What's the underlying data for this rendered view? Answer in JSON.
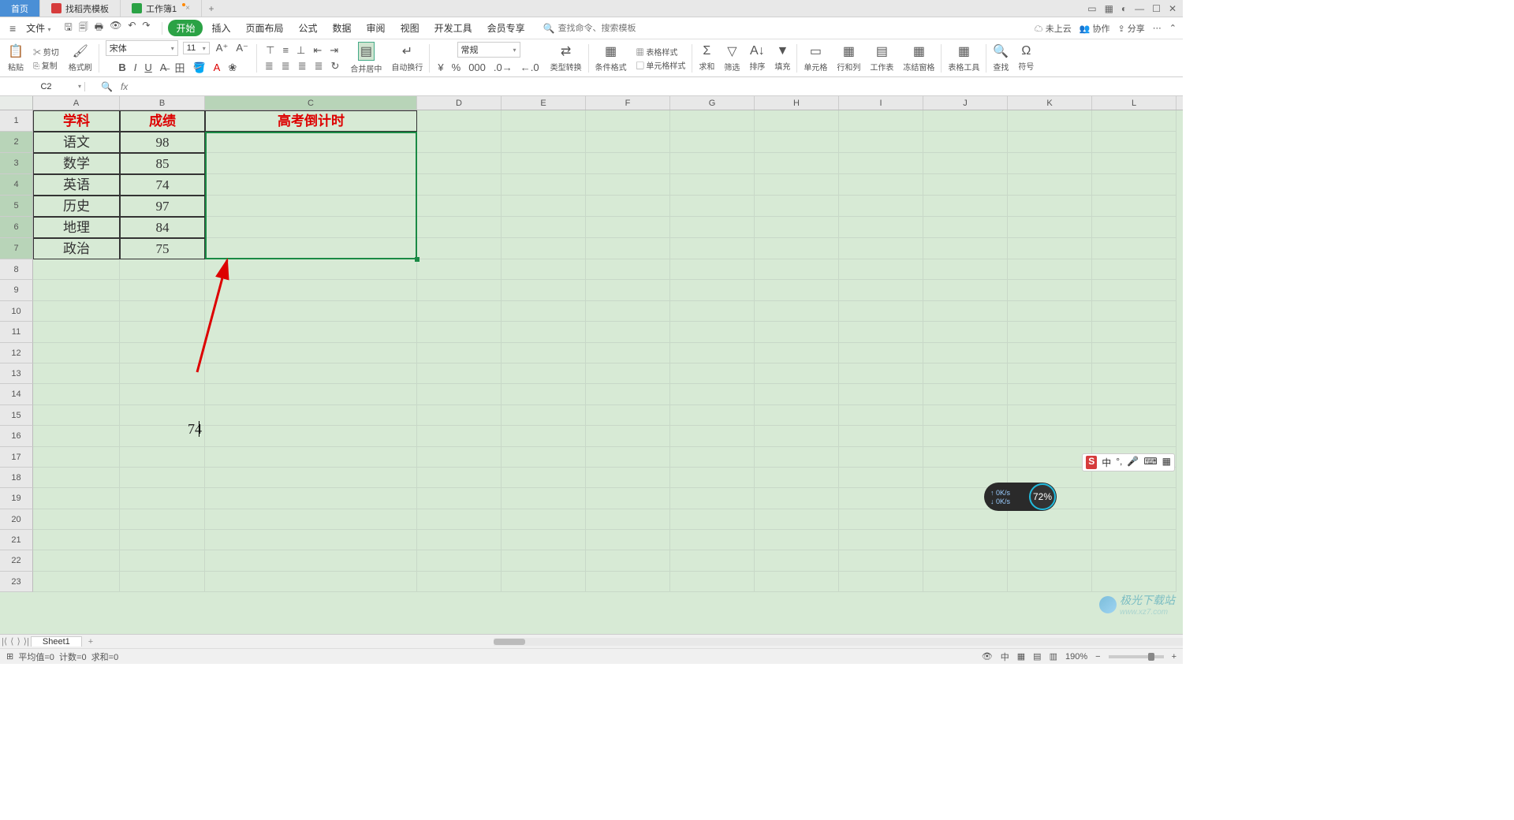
{
  "tabs": {
    "home": "首页",
    "templates": "找稻壳模板",
    "workbook": "工作簿1"
  },
  "menu": {
    "file": "文件",
    "items": [
      "开始",
      "插入",
      "页面布局",
      "公式",
      "数据",
      "审阅",
      "视图",
      "开发工具",
      "会员专享"
    ],
    "search_placeholder": "查找命令、搜索模板",
    "cloud": "未上云",
    "coop": "协作",
    "share": "分享"
  },
  "ribbon": {
    "paste": "粘贴",
    "cut": "剪切",
    "copy": "复制",
    "format_painter": "格式刷",
    "font_name": "宋体",
    "font_size": "11",
    "merge": "合并居中",
    "wrap": "自动换行",
    "number_fmt": "常规",
    "type_convert": "类型转换",
    "cond_fmt": "条件格式",
    "table_style": "表格样式",
    "cell_style": "单元格样式",
    "sum": "求和",
    "filter": "筛选",
    "sort": "排序",
    "fill": "填充",
    "cell": "单元格",
    "rows_cols": "行和列",
    "worksheet": "工作表",
    "freeze": "冻结窗格",
    "table_tools": "表格工具",
    "find": "查找",
    "symbol": "符号"
  },
  "namebox": "C2",
  "columns": [
    "A",
    "B",
    "C",
    "D",
    "E",
    "F",
    "G",
    "H",
    "I",
    "J",
    "K",
    "L"
  ],
  "rows_n": 23,
  "table": {
    "headers": [
      "学科",
      "成绩",
      "高考倒计时"
    ],
    "data": [
      [
        "语文",
        "98"
      ],
      [
        "数学",
        "85"
      ],
      [
        "英语",
        "74"
      ],
      [
        "历史",
        "97"
      ],
      [
        "地理",
        "84"
      ],
      [
        "政治",
        "75"
      ]
    ]
  },
  "floating_text": "74",
  "sheet": {
    "name": "Sheet1"
  },
  "status": {
    "avg": "平均值=0",
    "count": "计数=0",
    "sum": "求和=0",
    "zoom": "190%"
  },
  "ime": {
    "lang": "中"
  },
  "speed": {
    "up": "0K/s",
    "down": "0K/s",
    "pct": "72%"
  },
  "watermark": {
    "name": "极光下载站",
    "url": "www.xz7.com"
  }
}
